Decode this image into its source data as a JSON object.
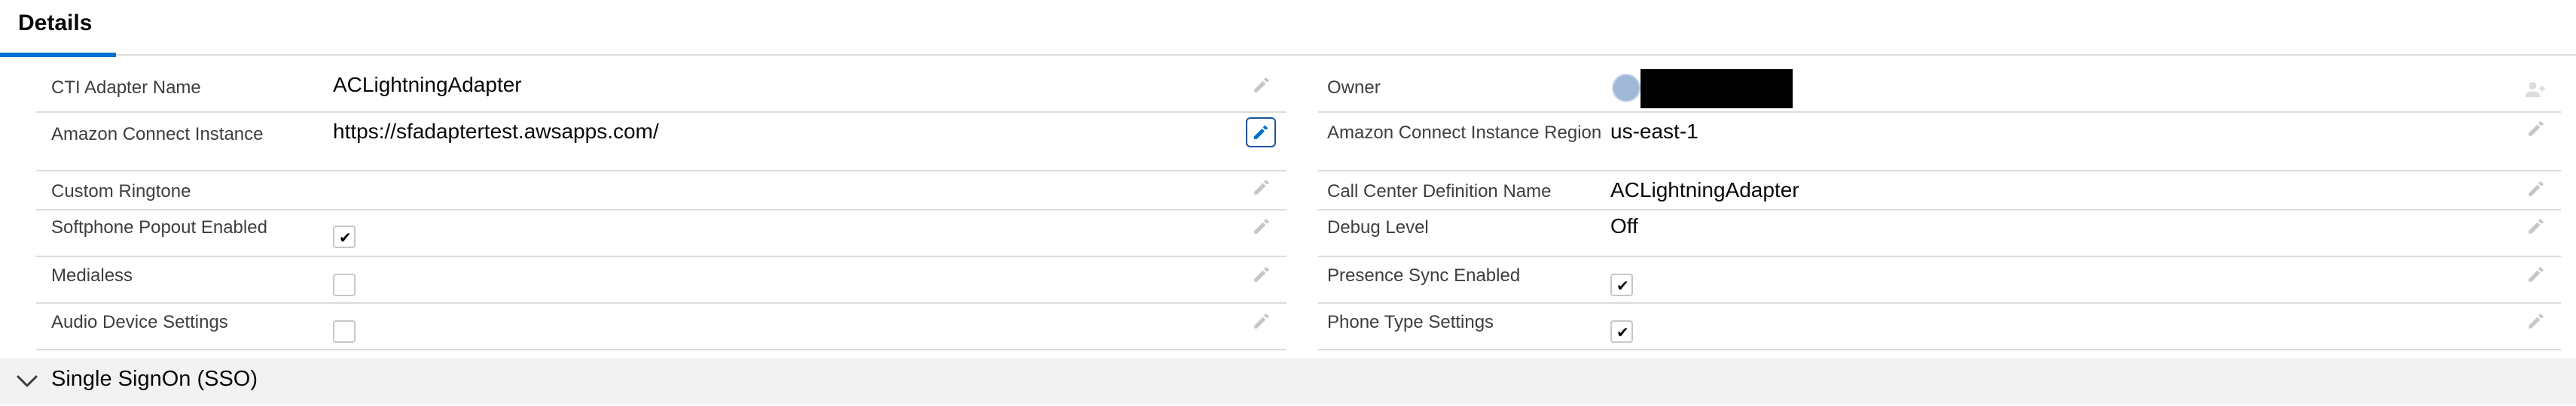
{
  "tabs": [
    {
      "label": "Details"
    }
  ],
  "left_fields": [
    {
      "label": "CTI Adapter Name",
      "value": "ACLightningAdapter"
    },
    {
      "label": "Amazon Connect Instance",
      "value": "https://sfadaptertest.awsapps.com/"
    },
    {
      "label": "Custom Ringtone",
      "value": ""
    },
    {
      "label": "Softphone Popout Enabled",
      "checked": true
    },
    {
      "label": "Medialess",
      "checked": false
    },
    {
      "label": "Audio Device Settings",
      "checked": false
    }
  ],
  "right_fields": [
    {
      "label": "Owner",
      "value": ""
    },
    {
      "label": "Amazon Connect Instance Region",
      "value": "us-east-1"
    },
    {
      "label": "Call Center Definition Name",
      "value": "ACLightningAdapter"
    },
    {
      "label": "Debug Level",
      "value": "Off"
    },
    {
      "label": "Presence Sync Enabled",
      "checked": true
    },
    {
      "label": "Phone Type Settings",
      "checked": true
    }
  ],
  "sections": [
    {
      "title": "Single SignOn (SSO)",
      "expanded": false
    }
  ],
  "icons": {
    "edit": "pencil-icon",
    "chevron": "chevron-down-icon",
    "avatar": "user-avatar-icon",
    "change_owner": "change-owner-icon"
  },
  "colors": {
    "accent": "#0070d2",
    "border": "#dddbda",
    "section_bg": "#f3f2f2",
    "label": "#3e3e3c"
  }
}
